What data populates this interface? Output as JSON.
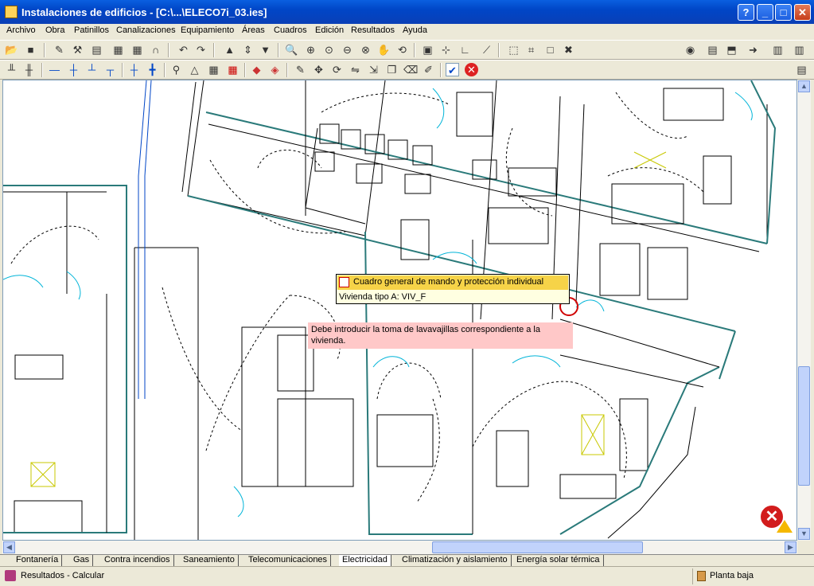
{
  "window": {
    "title": "Instalaciones de edificios - [C:\\...\\ELECO7i_03.ies]",
    "help_glyph": "?",
    "min_glyph": "_",
    "max_glyph": "□",
    "close_glyph": "✕"
  },
  "menu": [
    "Archivo",
    "Obra",
    "Patinillos",
    "Canalizaciones",
    "Equipamiento",
    "Áreas",
    "Cuadros",
    "Edición",
    "Resultados",
    "Ayuda"
  ],
  "canvas": {
    "tooltip_title": "Cuadro general de mando y protección individual",
    "tooltip_sub": "Vivienda tipo A: VIV_F",
    "warning": "Debe introducir la toma de lavavajillas correspondiente a la vivienda."
  },
  "tabs": [
    "Fontanería",
    "Gas",
    "Contra incendios",
    "Saneamiento",
    "Telecomunicaciones",
    "Electricidad",
    "Climatización y aislamiento",
    "Energía solar térmica"
  ],
  "active_tab": "Electricidad",
  "status": {
    "left": "Resultados - Calcular",
    "right": "Planta baja"
  },
  "colors": {
    "accent": "#0046c7",
    "wall_teal": "#2a7a7a",
    "tooltip_yellow": "#f6d348",
    "warning_pink": "#ffc8c8"
  }
}
